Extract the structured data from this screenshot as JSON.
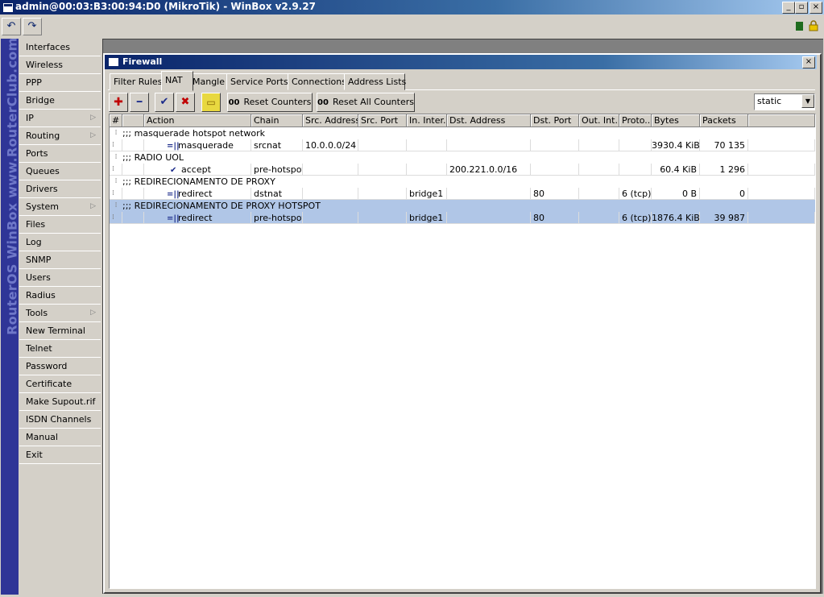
{
  "window": {
    "title": "admin@00:03:B3:00:94:D0 (MikroTik) - WinBox v2.9.27",
    "minimize": "_",
    "maximize": "▫",
    "close": "×"
  },
  "toolbar": {
    "undo_icon": "↶",
    "redo_icon": "↷"
  },
  "branding": "RouterOS WinBox   www.RouterClub.com",
  "sidebar": {
    "items": [
      {
        "label": "Interfaces"
      },
      {
        "label": "Wireless"
      },
      {
        "label": "PPP"
      },
      {
        "label": "Bridge"
      },
      {
        "label": "IP",
        "submenu": true
      },
      {
        "label": "Routing",
        "submenu": true
      },
      {
        "label": "Ports"
      },
      {
        "label": "Queues"
      },
      {
        "label": "Drivers"
      },
      {
        "label": "System",
        "submenu": true
      },
      {
        "label": "Files"
      },
      {
        "label": "Log"
      },
      {
        "label": "SNMP"
      },
      {
        "label": "Users"
      },
      {
        "label": "Radius"
      },
      {
        "label": "Tools",
        "submenu": true
      },
      {
        "label": "New Terminal"
      },
      {
        "label": "Telnet"
      },
      {
        "label": "Password"
      },
      {
        "label": "Certificate"
      },
      {
        "label": "Make Supout.rif"
      },
      {
        "label": "ISDN Channels"
      },
      {
        "label": "Manual"
      },
      {
        "label": "Exit"
      }
    ],
    "submenu_arrow": "▷"
  },
  "firewall": {
    "title": "Firewall",
    "close": "×",
    "tabs": [
      "Filter Rules",
      "NAT",
      "Mangle",
      "Service Ports",
      "Connections",
      "Address Lists"
    ],
    "active_tab": "NAT",
    "actions": {
      "add_icon": "✚",
      "remove_icon": "━",
      "enable_icon": "✔",
      "disable_icon": "✖",
      "comment_icon": "▭",
      "reset_counters": "Reset Counters",
      "reset_all_counters": "Reset All Counters",
      "oo": "00"
    },
    "filter": {
      "value": "static",
      "arrow": "▼"
    },
    "columns": [
      "#",
      "",
      "Action",
      "Chain",
      "Src. Address",
      "Src. Port",
      "In. Inter...",
      "Dst. Address",
      "Dst. Port",
      "Out. Int...",
      "Proto...",
      "Bytes",
      "Packets"
    ],
    "rules": [
      {
        "comment": ";;; masquerade hotspot network",
        "num": "0",
        "action": "masquerade",
        "action_icon": "=||",
        "chain": "srcnat",
        "src_address": "10.0.0.0/24",
        "src_port": "",
        "in_interface": "",
        "dst_address": "",
        "dst_port": "",
        "out_interface": "",
        "protocol": "",
        "bytes": "3930.4 KiB",
        "packets": "70 135",
        "selected": false
      },
      {
        "comment": ";;; RADIO UOL",
        "num": "1",
        "action": "accept",
        "action_icon": "✔",
        "chain": "pre-hotspot",
        "src_address": "",
        "src_port": "",
        "in_interface": "",
        "dst_address": "200.221.0.0/16",
        "dst_port": "",
        "out_interface": "",
        "protocol": "",
        "bytes": "60.4 KiB",
        "packets": "1 296",
        "selected": false
      },
      {
        "comment": ";;; REDIRECIONAMENTO DE PROXY",
        "num": "2",
        "action": "redirect",
        "action_icon": "=||",
        "chain": "dstnat",
        "src_address": "",
        "src_port": "",
        "in_interface": "bridge1",
        "dst_address": "",
        "dst_port": "80",
        "out_interface": "",
        "protocol": "6 (tcp)",
        "bytes": "0 B",
        "packets": "0",
        "selected": false
      },
      {
        "comment": ";;; REDIRECIONAMENTO DE PROXY HOTSPOT",
        "num": "3",
        "action": "redirect",
        "action_icon": "=||",
        "chain": "pre-hotspot",
        "src_address": "",
        "src_port": "",
        "in_interface": "bridge1",
        "dst_address": "",
        "dst_port": "80",
        "out_interface": "",
        "protocol": "6 (tcp)",
        "bytes": "1876.4 KiB",
        "packets": "39 987",
        "selected": true
      }
    ]
  }
}
